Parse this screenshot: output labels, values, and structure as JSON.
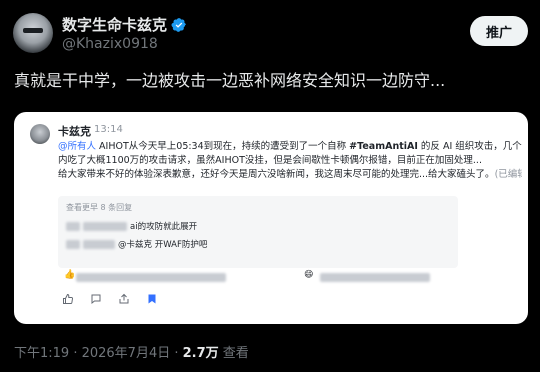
{
  "author": {
    "display_name": "数字生命卡兹克",
    "handle": "@Khazix0918",
    "verified_icon": "verified-badge-icon"
  },
  "actions": {
    "promote_label": "推广"
  },
  "tweet": {
    "text": "真就是干中学，一边被攻击一边恶补网络安全知识一边防守..."
  },
  "embedded_chat": {
    "sender": "卡兹克",
    "time": "13:14",
    "mention": "@所有人",
    "message_parts": [
      "AIHOT从今天早上05:34到现在，持续的遭受到了一个自称 ",
      "#TeamAntiAI",
      " 的反 AI 组织攻击，几个小",
      "内吃了大概1100万的攻击请求，虽然AIHOT没挂，但是会间歇性卡顿偶尔报错，目前正在加固处理...",
      "给大家带来不好的体验深表歉意，还好今天是周六没啥新闻，我这周末尽可能的处理完...给大家磕头了。",
      "(已编辑"
    ],
    "replies_header": "查看更早 8 条回复",
    "replies": [
      {
        "text": "ai的攻防就此展开"
      },
      {
        "text": "@卡兹克 开WAF防护吧"
      }
    ],
    "reaction_icons": [
      "emoji-reaction-icon",
      "emoji-reaction-icon",
      "smile-emoji-icon",
      "emoji-reaction-icon"
    ],
    "toolbar_icons": [
      "thumbs-up-icon",
      "chat-bubble-icon",
      "share-icon",
      "bookmark-icon"
    ]
  },
  "meta": {
    "time": "下午1:19 · 2026年7月4日 · ",
    "views_count": "2.7万",
    "views_label": " 查看"
  },
  "colors": {
    "background": "#000000",
    "text_primary": "#e7e9ea",
    "text_secondary": "#71767b",
    "verified": "#1d9bf0",
    "mention": "#3370ff",
    "bookmark": "#3370ff"
  }
}
